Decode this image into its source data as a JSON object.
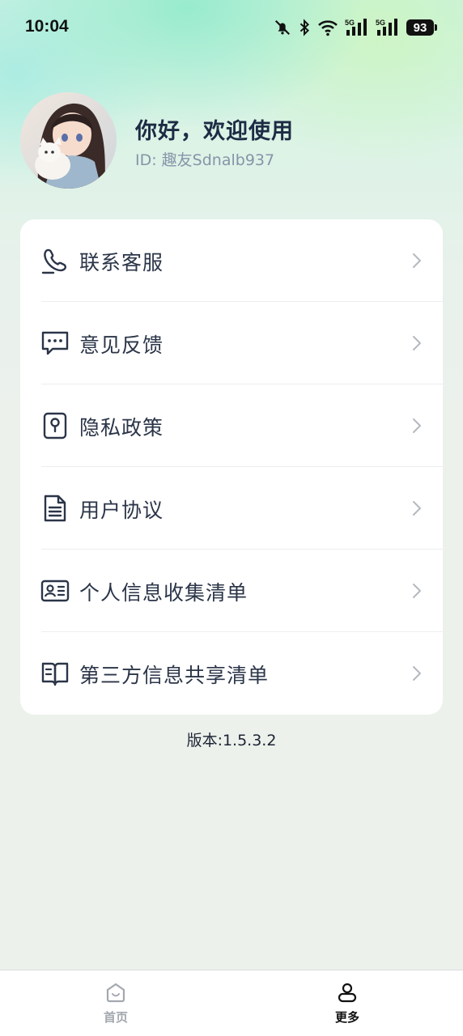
{
  "status_bar": {
    "time": "10:04",
    "battery": "93",
    "icons": [
      "bell-off-icon",
      "bluetooth-icon",
      "wifi-icon",
      "signal-5g-icon",
      "signal-5g-icon",
      "battery-icon"
    ],
    "network_label": "5G"
  },
  "profile": {
    "greeting": "你好，欢迎使用",
    "id_text": "ID: 趣友Sdnalb937"
  },
  "menu": [
    {
      "label": "联系客服",
      "icon": "phone-service-icon"
    },
    {
      "label": "意见反馈",
      "icon": "feedback-chat-icon"
    },
    {
      "label": "隐私政策",
      "icon": "privacy-lock-icon"
    },
    {
      "label": "用户协议",
      "icon": "document-icon"
    },
    {
      "label": "个人信息收集清单",
      "icon": "id-card-icon"
    },
    {
      "label": "第三方信息共享清单",
      "icon": "open-book-icon"
    }
  ],
  "version": "版本:1.5.3.2",
  "tabs": [
    {
      "label": "首页",
      "icon": "home-icon",
      "active": false
    },
    {
      "label": "更多",
      "icon": "user-icon",
      "active": true
    }
  ],
  "colors": {
    "title": "#1d2b44",
    "subtitle": "#8694a8",
    "tab_active": "#111111",
    "tab_inactive": "#a3a8b0"
  }
}
